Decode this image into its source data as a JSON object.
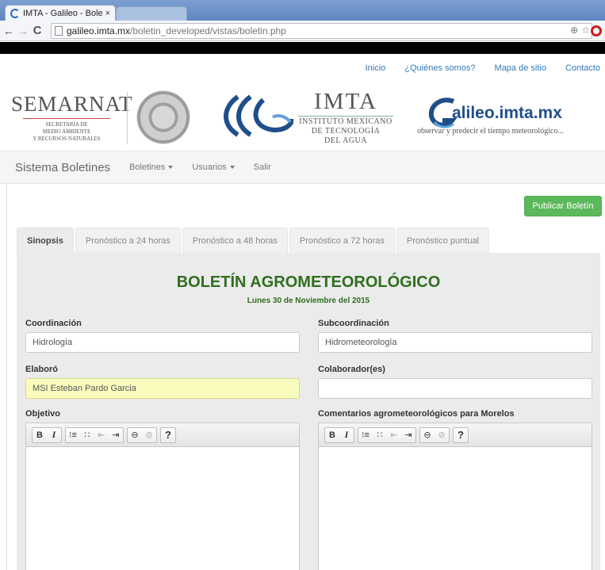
{
  "browser": {
    "tab_title": "IMTA - Galileo - Boletín",
    "tab_close": "×",
    "url_host": "galileo.imta.mx",
    "url_path": "/boletin_developed/vistas/boletin.php",
    "back_glyph": "←",
    "forward_glyph": "→",
    "reload_glyph": "C",
    "zoom_glyph": "⊕",
    "star_glyph": "☆"
  },
  "header": {
    "top_links": [
      "Inicio",
      "¿Quiénes somos?",
      "Mapa de sitio",
      "Contacto"
    ],
    "semarnat": {
      "name": "SEMARNAT",
      "sub1": "SECRETARÍA DE",
      "sub2": "MEDIO AMBIENTE",
      "sub3": "Y RECURSOS NATURALES"
    },
    "imta": {
      "name": "IMTA",
      "sub1": "INSTITUTO MEXICANO",
      "sub2": "DE TECNOLOGÍA",
      "sub3": "DEL AGUA"
    },
    "galileo": {
      "name": "alileo.imta.mx",
      "tagline": "observar y predecir el tiempo meteorológico..."
    }
  },
  "navbar": {
    "brand": "Sistema Boletines",
    "items": [
      "Boletines",
      "Usuarios",
      "Salir"
    ]
  },
  "main": {
    "publish_label": "Publicar Boletín",
    "tabs": [
      "Sinopsis",
      "Pronóstico a 24 horas",
      "Pronóstico a 48 horas",
      "Pronóstico a 72 horas",
      "Pronóstico puntual"
    ],
    "title": "BOLETÍN AGROMETEOROLÓGICO",
    "date": "Lunes 30 de Noviembre del 2015",
    "coordinacion_label": "Coordinación",
    "coordinacion_value": "Hidrología",
    "subcoordinacion_label": "Subcoordinación",
    "subcoordinacion_value": "Hidrometeorología",
    "elaboro_label": "Elaboró",
    "elaboro_value": "MSI Esteban Pardo Garcia",
    "colaborador_label": "Colaborador(es)",
    "colaborador_value": "",
    "objetivo_label": "Objetivo",
    "comentarios_label": "Comentarios agrometeorológicos para Morelos",
    "editor_toolbar": {
      "bold": "B",
      "italic": "I",
      "ordered_list": "⁝≡",
      "unordered_list": "∷",
      "outdent": "⇤",
      "indent": "⇥",
      "link": "⊖",
      "unlink": "⊘",
      "help": "?"
    }
  },
  "colors": {
    "accent_green": "#5cb85c",
    "title_green": "#2f6e1f",
    "link_blue": "#337ab7"
  }
}
